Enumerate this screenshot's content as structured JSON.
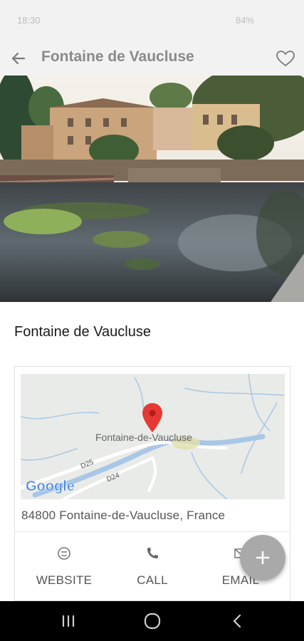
{
  "status_bar": {
    "time": "18:30",
    "right_text": "84%"
  },
  "app_bar": {
    "title": "Fontaine de Vaucluse"
  },
  "hero": {
    "alt": "Fontaine de Vaucluse photo"
  },
  "place": {
    "name": "Fontaine de Vaucluse"
  },
  "map": {
    "town_label": "Fontaine-de-Vaucluse",
    "road_label_1": "D25",
    "road_label_2": "D24",
    "logo": "Google"
  },
  "address": "84800 Fontaine-de-Vaucluse, France",
  "actions": [
    {
      "label": "WEBSITE",
      "icon": "website-icon"
    },
    {
      "label": "CALL",
      "icon": "phone-icon"
    },
    {
      "label": "EMAIL",
      "icon": "email-icon"
    }
  ],
  "fab": {
    "icon": "plus-icon"
  },
  "colors": {
    "accent_pin": "#e53935",
    "fab": "#a9a9a9",
    "app_bar": "#f2f2f2"
  }
}
